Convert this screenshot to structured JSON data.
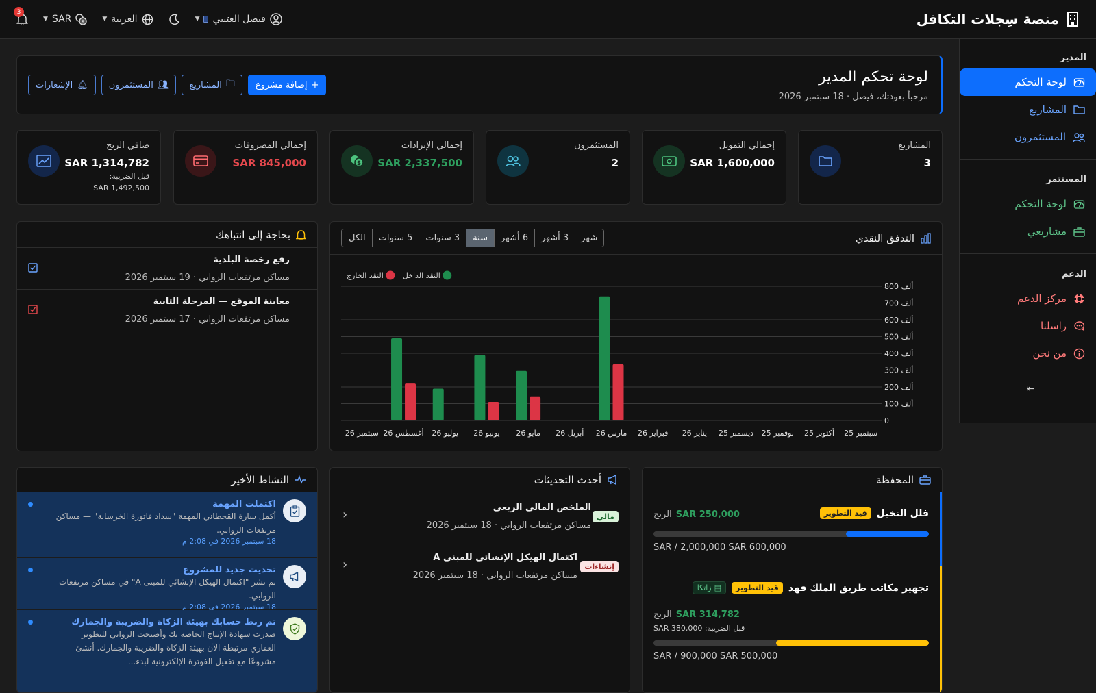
{
  "app": {
    "title": "منصة سِجلات التكافل",
    "currency": "SAR",
    "language": "العربية",
    "user": "فيصل العتيبي",
    "notif_count": "3"
  },
  "sidebar": {
    "sections": [
      {
        "title": "المدير",
        "items": [
          {
            "label": "لوحة التحكم",
            "active": true
          },
          {
            "label": "المشاريع"
          },
          {
            "label": "المستثمرون"
          }
        ]
      },
      {
        "title": "المستثمر",
        "items": [
          {
            "label": "لوحة التحكم"
          },
          {
            "label": "مشاريعي"
          }
        ]
      },
      {
        "title": "الدعم",
        "items": [
          {
            "label": "مركز الدعم"
          },
          {
            "label": "راسلنا"
          },
          {
            "label": "من نحن"
          }
        ]
      }
    ]
  },
  "header": {
    "title": "لوحة تحكم المدير",
    "subtitle": "مرحباً بعودتك، فيصل · 18 سبتمبر 2026",
    "buttons": {
      "add": "إضافة مشروع",
      "projects": "المشاريع",
      "investors": "المستثمرون",
      "notifications": "الإشعارات"
    }
  },
  "stats": [
    {
      "label": "المشاريع",
      "value": "3",
      "color": "#ffffff"
    },
    {
      "label": "إجمالي التمويل",
      "value": "1,600,000 SAR",
      "color": "#ffffff"
    },
    {
      "label": "المستثمرون",
      "value": "2",
      "color": "#ffffff"
    },
    {
      "label": "إجمالي الإيرادات",
      "value": "2,337,500 SAR",
      "color": "#2e9e5e"
    },
    {
      "label": "إجمالي المصروفات",
      "value": "845,000 SAR",
      "color": "#e5484d"
    },
    {
      "label": "صافي الربح",
      "value": "1,314,782 SAR",
      "color": "#ffffff",
      "sub_label": "قبل الضريبة:",
      "sub_value": "1,492,500 SAR"
    }
  ],
  "cashflow": {
    "title": "التدفق النقدي",
    "ranges": [
      "شهر",
      "3 أشهر",
      "6 أشهر",
      "سنة",
      "3 سنوات",
      "5 سنوات",
      "الكل"
    ],
    "active_range": "سنة",
    "legend": {
      "in": "النقد الداخل",
      "out": "النقد الخارج"
    }
  },
  "chart_data": {
    "type": "bar",
    "categories": [
      "سبتمبر 25",
      "أكتوبر 25",
      "نوفمبر 25",
      "ديسمبر 25",
      "يناير 26",
      "فبراير 26",
      "مارس 26",
      "أبريل 26",
      "مايو 26",
      "يونيو 26",
      "يوليو 26",
      "أغسطس 26",
      "سبتمبر 26"
    ],
    "series": [
      {
        "name": "النقد الداخل",
        "color": "#1e8c4e",
        "values": [
          0,
          0,
          0,
          0,
          0,
          0,
          740000,
          0,
          295000,
          390000,
          190000,
          490000,
          0
        ]
      },
      {
        "name": "النقد الخارج",
        "color": "#dc3545",
        "values": [
          0,
          0,
          0,
          0,
          0,
          0,
          335000,
          0,
          140000,
          110000,
          0,
          220000,
          0
        ]
      }
    ],
    "yticks": [
      "0",
      "100 ألف",
      "200 ألف",
      "300 ألف",
      "400 ألف",
      "500 ألف",
      "600 ألف",
      "700 ألف",
      "800 ألف"
    ],
    "ylim": [
      0,
      800000
    ]
  },
  "attention": {
    "title": "بحاجة إلى انتباهك",
    "items": [
      {
        "title": "رفع رخصة البلدية",
        "sub": "مساكن مرتفعات الروابي · 19 سبتمبر 2026"
      },
      {
        "title": "معاينة الموقع — المرحلة الثانية",
        "sub": "مساكن مرتفعات الروابي · 17 سبتمبر 2026"
      }
    ]
  },
  "portfolio": {
    "title": "المحفظة",
    "profit_label": "الربح",
    "items": [
      {
        "name": "فلل النخيل",
        "status": "قيد التطوير",
        "profit": "250,000 SAR",
        "amounts": "600,000 SAR / 2,000,000 SAR",
        "progress": 0.3,
        "color": "#0d6efd"
      },
      {
        "name": "تجهيز مكاتب طريق الملك فهد",
        "status": "قيد التطوير",
        "tag": "زاتكا",
        "profit": "314,782 SAR",
        "pretax": "قبل الضريبة: 380,000 SAR",
        "amounts": "500,000 SAR / 900,000 SAR",
        "progress": 0.555,
        "color": "#ffc107"
      }
    ]
  },
  "updates": {
    "title": "أحدث التحديثات",
    "items": [
      {
        "tag": "مالي",
        "title": "الملخص المالي الربعي",
        "sub": "مساكن مرتفعات الروابي · 18 سبتمبر 2026"
      },
      {
        "tag": "إنشاءات",
        "title": "اكتمال الهيكل الإنشائي للمبنى A",
        "sub": "مساكن مرتفعات الروابي · 18 سبتمبر 2026"
      }
    ]
  },
  "activity": {
    "title": "النشاط الأخير",
    "items": [
      {
        "title": "اكتملت المهمة",
        "desc": "أكمل سارة القحطاني المهمة \"سداد فاتورة الخرسانة\" — مساكن مرتفعات الروابي.",
        "time": "18 سبتمبر 2026 في 2:08 م"
      },
      {
        "title": "تحديث جديد للمشروع",
        "desc": "تم نشر \"اكتمال الهيكل الإنشائي للمبنى A\" في مساكن مرتفعات الروابي.",
        "time": "18 سبتمبر 2026 في 2:08 م"
      },
      {
        "title": "تم ربط حسابك بهيئة الزكاة والضريبة والجمارك",
        "desc": "صدرت شهادة الإنتاج الخاصة بك وأصبحت الروابي للتطوير العقاري مرتبطة الآن بهيئة الزكاة والضريبة والجمارك. أنشئ مشروعًا مع تفعيل الفوترة الإلكترونية لبدء...",
        "time": ""
      }
    ]
  }
}
